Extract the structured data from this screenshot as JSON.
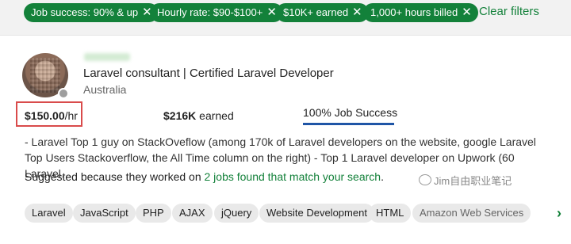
{
  "filters": {
    "chips": [
      {
        "label": "Job success: 90% & up"
      },
      {
        "label": "Hourly rate: $90-$100+"
      },
      {
        "label": "$10K+ earned"
      },
      {
        "label": "1,000+ hours billed"
      }
    ],
    "clear_label": "Clear filters",
    "remove_glyph": "✕"
  },
  "freelancer": {
    "title": "Laravel consultant | Certified Laravel Developer",
    "location": "Australia",
    "rate_amount": "$150.00",
    "rate_unit": "/hr",
    "earned_amount": "$216K",
    "earned_label": " earned",
    "job_success": "100% Job Success",
    "job_success_percent": 100,
    "description": "- Laravel Top 1 guy on StackOveflow (among 170k of Laravel developers on the website, google Laravel Top Users Stackoverflow, the All Time column on the right) - Top 1 Laravel developer on Upwork (60 Laravel…",
    "suggested_prefix": "Suggested because they worked on ",
    "suggested_link": "2 jobs found that match your search",
    "suggested_suffix": ".",
    "skills": [
      {
        "label": "Laravel"
      },
      {
        "label": "JavaScript"
      },
      {
        "label": "PHP"
      },
      {
        "label": "AJAX"
      },
      {
        "label": "jQuery"
      },
      {
        "label": "Website Development"
      },
      {
        "label": "HTML"
      },
      {
        "label": "Amazon Web Services"
      }
    ],
    "next_glyph": "›"
  },
  "watermark": "Jim自由职业笔记",
  "colors": {
    "accent": "#13813a",
    "highlight_box": "#d94b4b",
    "job_success_bar": "#1f55a6"
  }
}
